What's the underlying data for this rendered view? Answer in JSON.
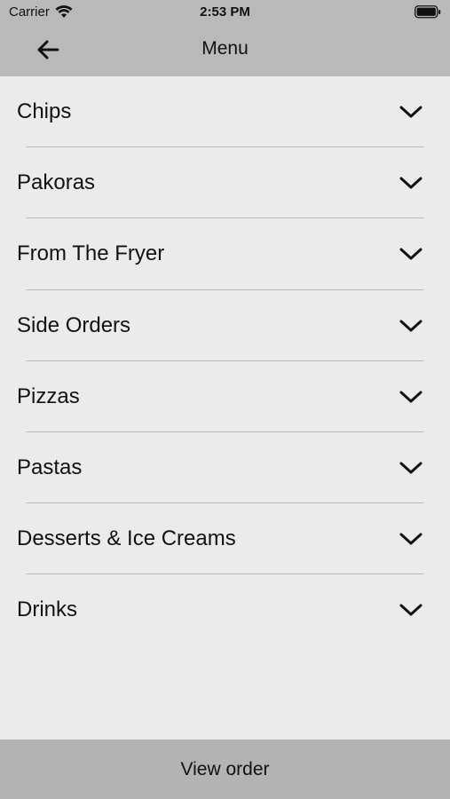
{
  "status_bar": {
    "carrier": "Carrier",
    "time": "2:53 PM"
  },
  "nav": {
    "title": "Menu",
    "back_icon": "arrow-left-icon"
  },
  "menu": {
    "items": [
      {
        "label": "Chips"
      },
      {
        "label": "Pakoras"
      },
      {
        "label": "From The Fryer"
      },
      {
        "label": "Side Orders"
      },
      {
        "label": "Pizzas"
      },
      {
        "label": "Pastas"
      },
      {
        "label": "Desserts & Ice Creams"
      },
      {
        "label": "Drinks"
      }
    ],
    "expand_icon": "chevron-down-icon"
  },
  "footer": {
    "button_label": "View order"
  },
  "colors": {
    "background": "#ebebeb",
    "top_bar": "#b9b9b9",
    "bottom_bar": "#b3b3b3",
    "divider": "#b9b9b9",
    "text": "#111111"
  }
}
